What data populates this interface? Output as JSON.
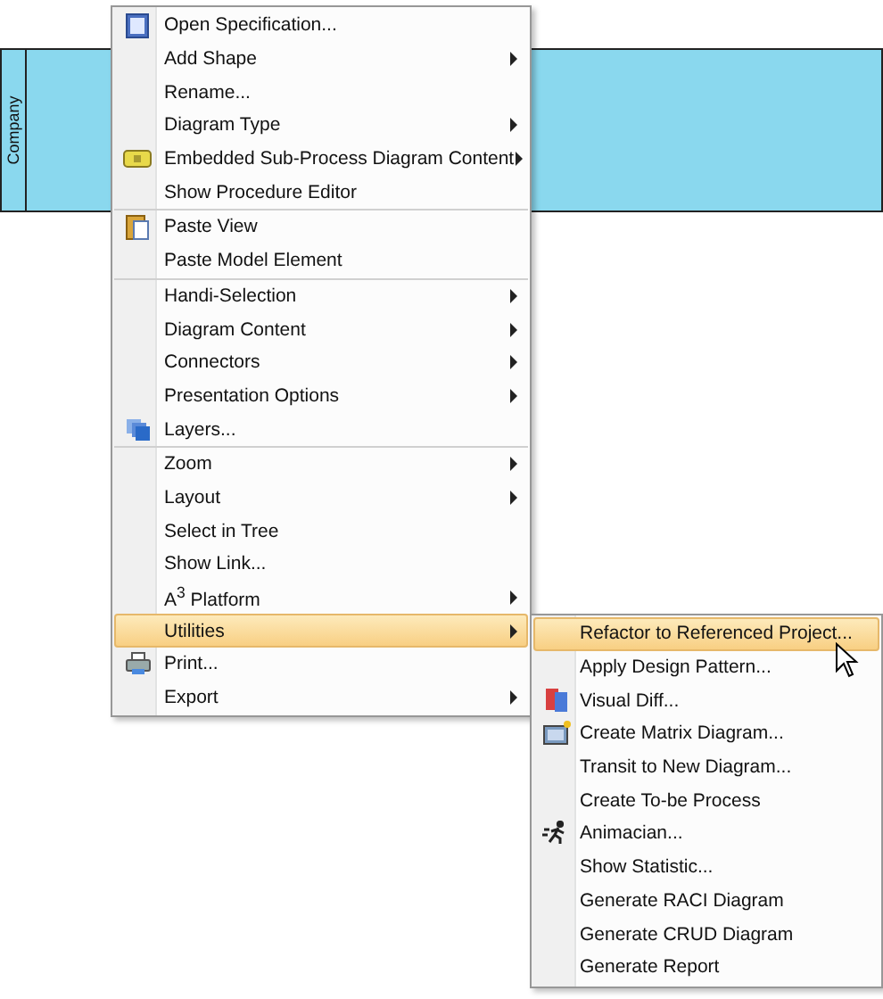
{
  "pool": {
    "label": "Company"
  },
  "context_menu": {
    "sections": [
      [
        {
          "label": "Open Specification...",
          "icon": true,
          "submenu": false,
          "selected": false
        },
        {
          "label": "Add Shape",
          "icon": false,
          "submenu": true,
          "selected": false
        },
        {
          "label": "Rename...",
          "icon": false,
          "submenu": false,
          "selected": false
        },
        {
          "label": "Diagram Type",
          "icon": false,
          "submenu": true,
          "selected": false
        },
        {
          "label": "Embedded Sub-Process Diagram Content",
          "icon": true,
          "submenu": true,
          "selected": false
        },
        {
          "label": "Show Procedure Editor",
          "icon": false,
          "submenu": false,
          "selected": false
        }
      ],
      [
        {
          "label": "Paste View",
          "icon": true,
          "submenu": false,
          "selected": false
        },
        {
          "label": "Paste Model Element",
          "icon": false,
          "submenu": false,
          "selected": false
        }
      ],
      [
        {
          "label": "Handi-Selection",
          "icon": false,
          "submenu": true,
          "selected": false
        },
        {
          "label": "Diagram Content",
          "icon": false,
          "submenu": true,
          "selected": false
        },
        {
          "label": "Connectors",
          "icon": false,
          "submenu": true,
          "selected": false
        },
        {
          "label": "Presentation Options",
          "icon": false,
          "submenu": true,
          "selected": false
        },
        {
          "label": "Layers...",
          "icon": true,
          "submenu": false,
          "selected": false
        }
      ],
      [
        {
          "label": "Zoom",
          "icon": false,
          "submenu": true,
          "selected": false
        },
        {
          "label": "Layout",
          "icon": false,
          "submenu": true,
          "selected": false
        },
        {
          "label": "Select in Tree",
          "icon": false,
          "submenu": false,
          "selected": false
        },
        {
          "label": "Show Link...",
          "icon": false,
          "submenu": false,
          "selected": false
        },
        {
          "label": "A$^{3}$ Platform",
          "icon": false,
          "submenu": true,
          "selected": false
        },
        {
          "label": "Utilities",
          "icon": false,
          "submenu": true,
          "selected": true
        },
        {
          "label": "Print...",
          "icon": true,
          "submenu": false,
          "selected": false
        },
        {
          "label": "Export",
          "icon": false,
          "submenu": true,
          "selected": false
        }
      ]
    ]
  },
  "submenu": {
    "sections": [
      [
        {
          "label": "Refactor to Referenced Project...",
          "icon": false,
          "submenu": false,
          "selected": true
        },
        {
          "label": "Apply Design Pattern...",
          "icon": false,
          "submenu": false,
          "selected": false
        },
        {
          "label": "Visual Diff...",
          "icon": true,
          "submenu": false,
          "selected": false
        },
        {
          "label": "Create Matrix Diagram...",
          "icon": true,
          "submenu": false,
          "selected": false
        },
        {
          "label": "Transit to New Diagram...",
          "icon": false,
          "submenu": false,
          "selected": false
        },
        {
          "label": "Create To-be Process",
          "icon": false,
          "submenu": false,
          "selected": false
        },
        {
          "label": "Animacian...",
          "icon": true,
          "submenu": false,
          "selected": false
        },
        {
          "label": "Show Statistic...",
          "icon": false,
          "submenu": false,
          "selected": false
        },
        {
          "label": "Generate RACI Diagram",
          "icon": false,
          "submenu": false,
          "selected": false
        },
        {
          "label": "Generate CRUD Diagram",
          "icon": false,
          "submenu": false,
          "selected": false
        },
        {
          "label": "Generate Report",
          "icon": false,
          "submenu": false,
          "selected": false
        }
      ]
    ]
  }
}
